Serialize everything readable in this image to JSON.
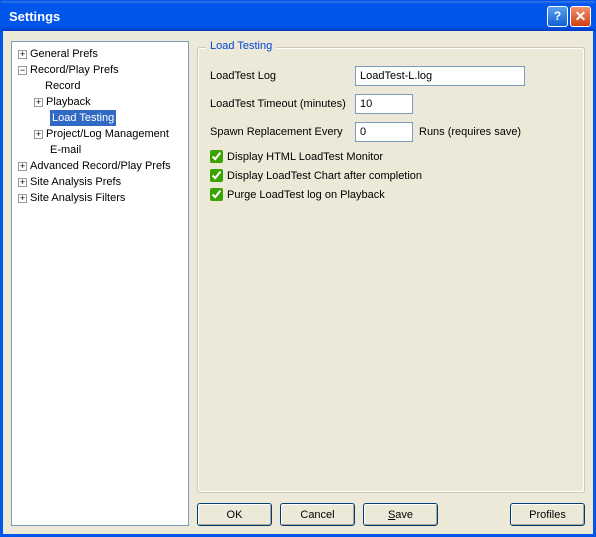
{
  "window": {
    "title": "Settings"
  },
  "tree": {
    "n0": "General Prefs",
    "n1": "Record/Play Prefs",
    "n1_0": "Record",
    "n1_1": "Playback",
    "n1_2": "Load Testing",
    "n1_3": "Project/Log Management",
    "n1_4": "E-mail",
    "n2": "Advanced Record/Play Prefs",
    "n3": "Site Analysis Prefs",
    "n4": "Site Analysis Filters"
  },
  "group": {
    "title": "Load Testing",
    "log_label": "LoadTest Log",
    "log_value": "LoadTest-L.log",
    "timeout_label": "LoadTest Timeout (minutes)",
    "timeout_value": "10",
    "spawn_label": "Spawn Replacement Every",
    "spawn_value": "0",
    "spawn_suffix": "Runs (requires save)",
    "cb1": "Display HTML LoadTest Monitor",
    "cb2": "Display LoadTest Chart after completion",
    "cb3": "Purge LoadTest log on Playback"
  },
  "buttons": {
    "ok": "OK",
    "cancel": "Cancel",
    "save": "Save",
    "profiles": "Profiles"
  }
}
